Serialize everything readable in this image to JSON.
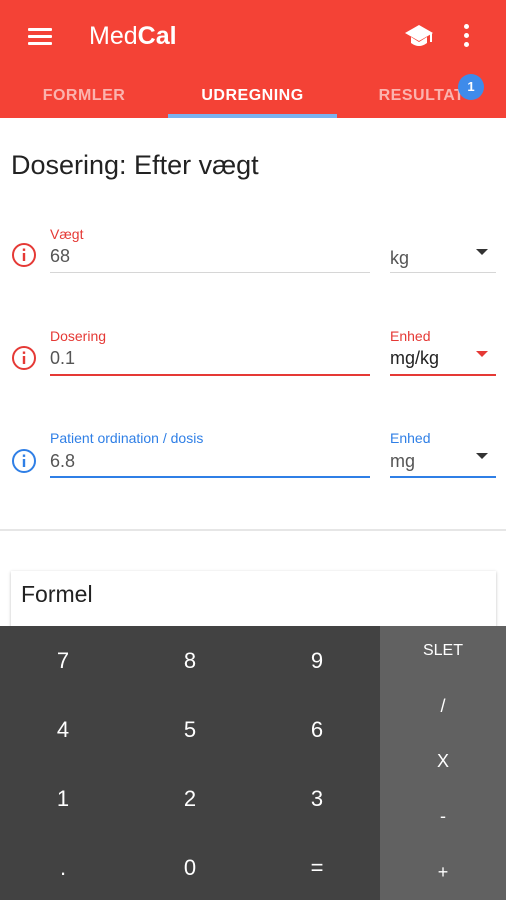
{
  "app": {
    "title_part1": "Med",
    "title_part2": "Cal",
    "menu_icon": "menu-icon",
    "school_icon": "school-icon",
    "more_icon": "more-vert-icon",
    "colors": {
      "primary": "#f44236",
      "accent": "#3e8bea",
      "error": "#e53935",
      "info": "#2f7fe6"
    }
  },
  "tabs": [
    {
      "label": "FORMLER"
    },
    {
      "label": "UDREGNING",
      "active": true
    },
    {
      "label": "RESULTAT",
      "badge": "1"
    }
  ],
  "page": {
    "title": "Dosering: Efter vægt"
  },
  "fields": {
    "weight": {
      "label": "Vægt",
      "value": "68",
      "unit_value": "kg"
    },
    "dosing": {
      "label": "Dosering",
      "value": "0.1",
      "unit_label": "Enhed",
      "unit_value": "mg/kg"
    },
    "patient": {
      "label": "Patient ordination / dosis",
      "value": "6.8",
      "unit_label": "Enhed",
      "unit_value": "mg"
    }
  },
  "formel": {
    "label": "Formel"
  },
  "keypad": {
    "row1": [
      "7",
      "8",
      "9"
    ],
    "row2": [
      "4",
      "5",
      "6"
    ],
    "row3": [
      "1",
      "2",
      "3"
    ],
    "row4": [
      ".",
      "0",
      "="
    ],
    "ops": [
      "SLET",
      "/",
      "X",
      "-",
      "+"
    ]
  }
}
